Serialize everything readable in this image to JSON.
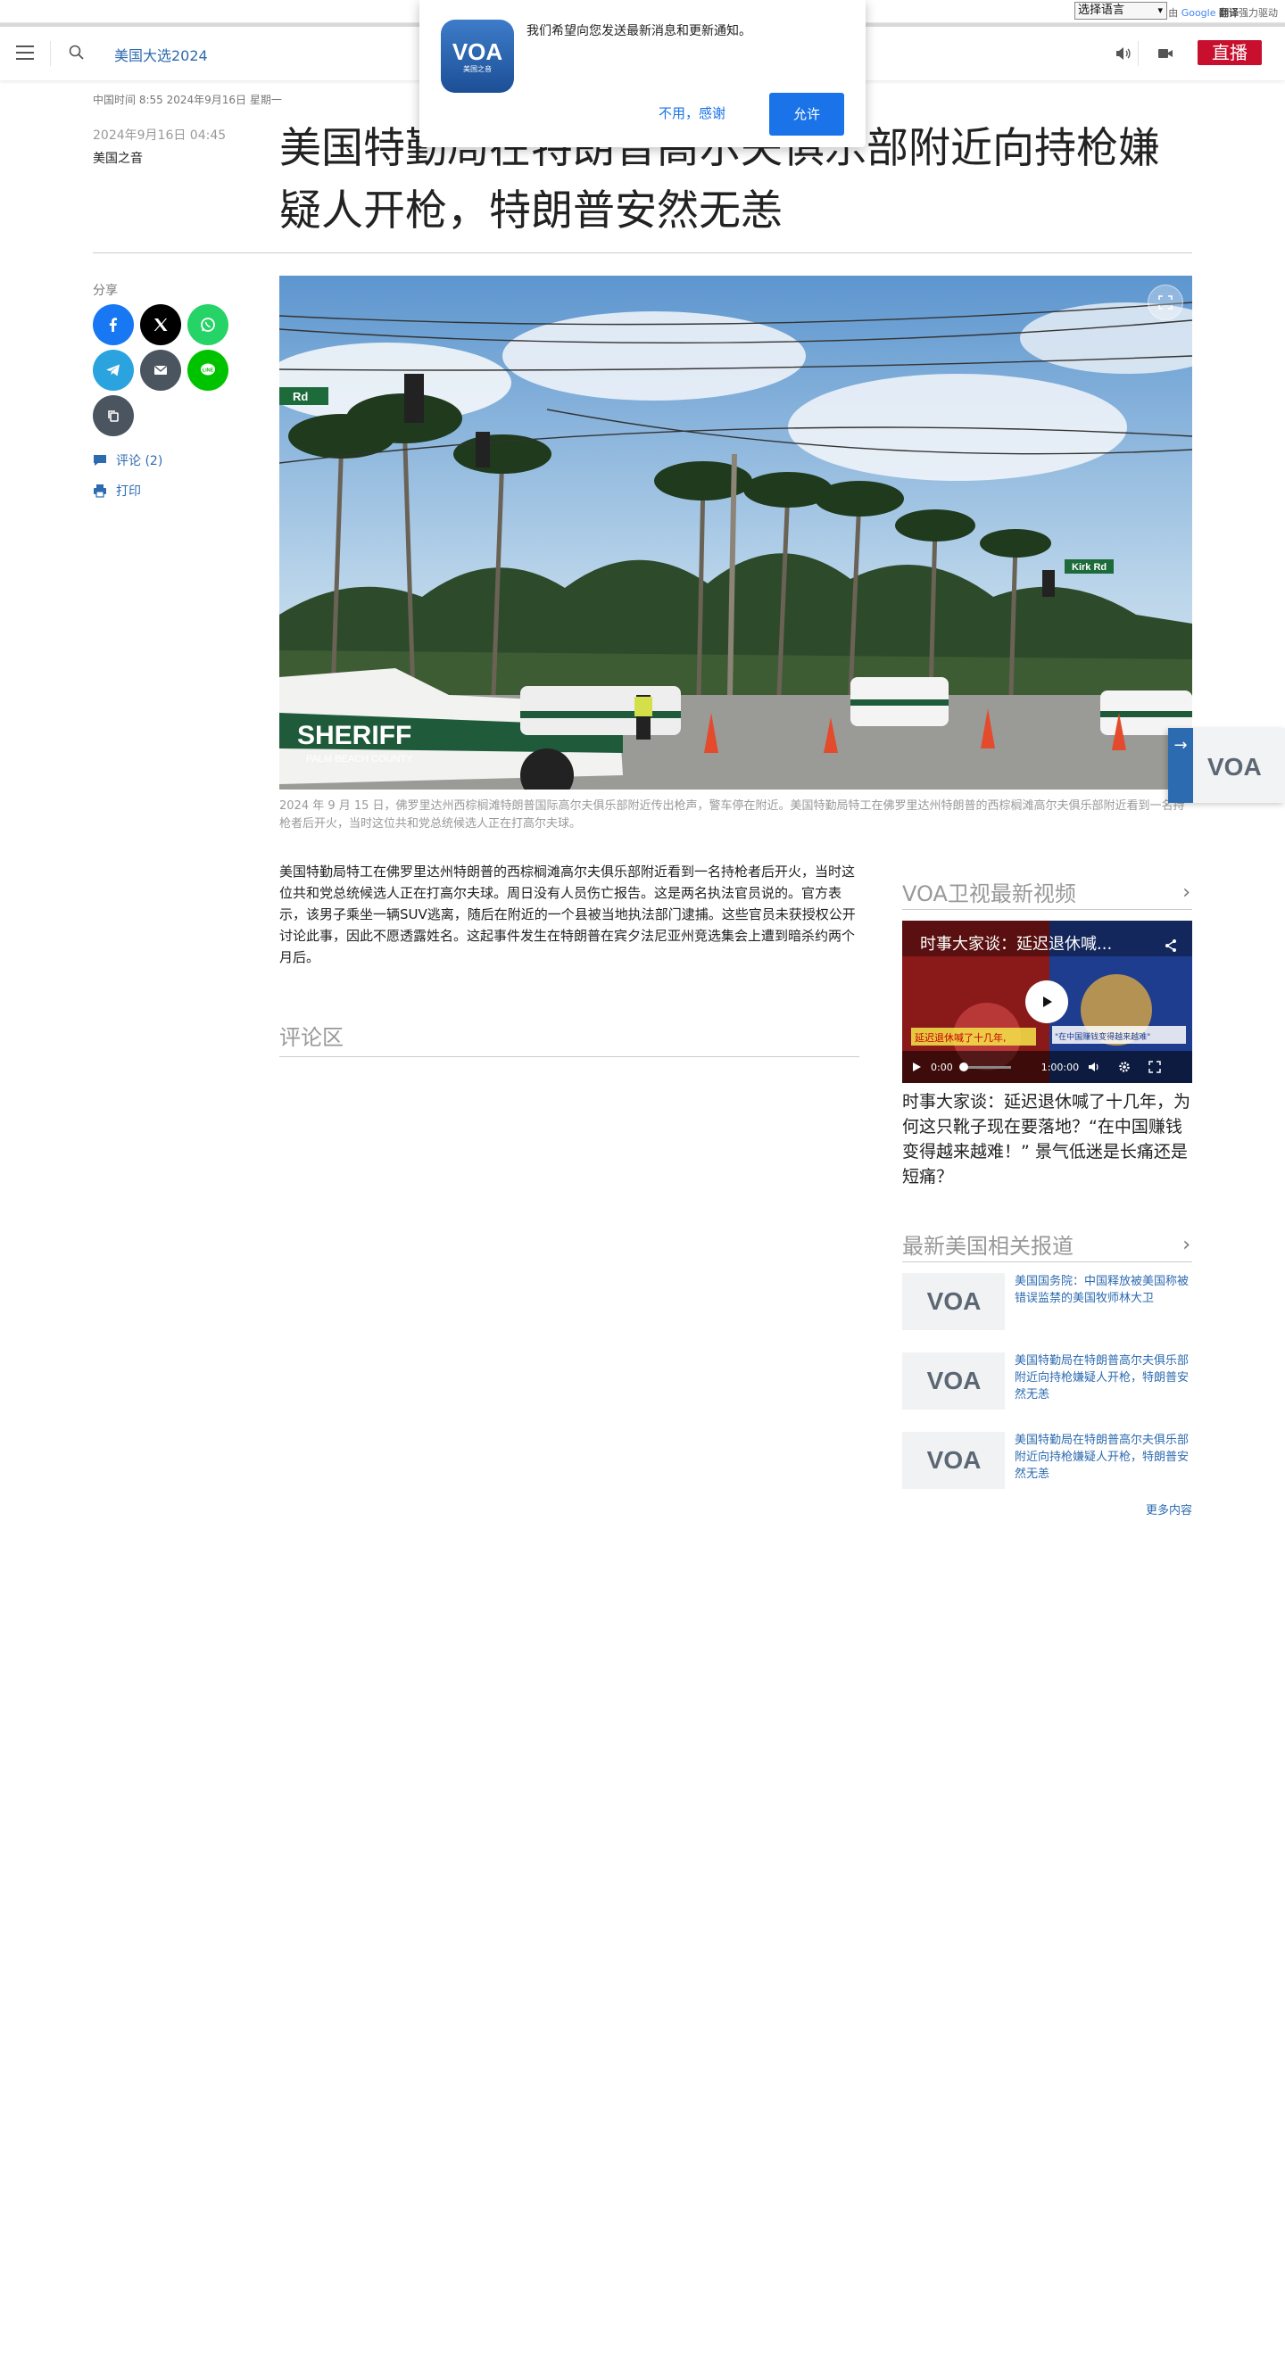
{
  "translate": {
    "select_label": "选择语言",
    "powered_prefix": "由",
    "powered_brand": "Google",
    "powered_suffix": "翻译",
    "powered_tail": "强力驱动"
  },
  "header": {
    "section_link": "美国大选2024",
    "live_label": "直播"
  },
  "local_time": "中国时间 8:55 2024年9月16日 星期一",
  "article": {
    "pub_date": "2024年9月16日 04:45",
    "author": "美国之音",
    "headline": "美国特勤局在特朗普高尔夫俱乐部附近向持枪嫌疑人开枪，特朗普安然无恙",
    "caption": "2024 年 9 月 15 日，佛罗里达州西棕榈滩特朗普国际高尔夫俱乐部附近传出枪声，警车停在附近。美国特勤局特工在佛罗里达州特朗普的西棕榈滩高尔夫俱乐部附近看到一名持枪者后开火，当时这位共和党总统候选人正在打高尔夫球。",
    "body": "美国特勤局特工在佛罗里达州特朗普的西棕榈滩高尔夫俱乐部附近看到一名持枪者后开火，当时这位共和党总统候选人正在打高尔夫球。周日没有人员伤亡报告。这是两名执法官员说的。官方表示，该男子乘坐一辆SUV逃离，随后在附近的一个县被当地执法部门逮捕。这些官员未获授权公开讨论此事，因此不愿透露姓名。这起事件发生在特朗普在宾夕法尼亚州竞选集会上遭到暗杀约两个月后。",
    "comments_title": "评论区"
  },
  "share": {
    "label": "分享",
    "comments_link": "评论 (2)",
    "print_link": "打印"
  },
  "hero_signs": {
    "sheriff": "SHERIFF",
    "county": "PALM BEACH COUNTY",
    "street1": "Rd",
    "street2": "Kirk Rd"
  },
  "sidebar": {
    "video_section_title": "VOA卫视最新视频",
    "video_overlay_title": "时事大家谈：延迟退休喊...",
    "video_time_current": "0:00",
    "video_time_total": "1:00:00",
    "video_thumb_text_left": "延迟退休喊了十几年,",
    "video_thumb_text_right": "\"在中国赚钱变得越来越难\"",
    "video_caption": "时事大家谈：延迟退休喊了十几年，为何这只靴子现在要落地？“在中国赚钱变得越来越难！” 景气低迷是长痛还是短痛？",
    "news_section_title": "最新美国相关报道",
    "news_items": [
      "美国国务院：中国释放被美国称被错误监禁的美国牧师林大卫",
      "美国特勤局在特朗普高尔夫俱乐部附近向持枪嫌疑人开枪，特朗普安然无恙",
      "美国特勤局在特朗普高尔夫俱乐部附近向持枪嫌疑人开枪，特朗普安然无恙"
    ],
    "more_link": "更多内容"
  },
  "notification": {
    "message": "我们希望向您发送最新消息和更新通知。",
    "deny_label": "不用，感谢",
    "allow_label": "允许",
    "logo_text": "VOA",
    "logo_subtext": "美国之音"
  },
  "float_widget": {
    "logo_text": "VOA"
  },
  "colors": {
    "link_blue": "#2d6bb0",
    "live_red": "#c8102e",
    "dialog_blue": "#1a73e8"
  }
}
